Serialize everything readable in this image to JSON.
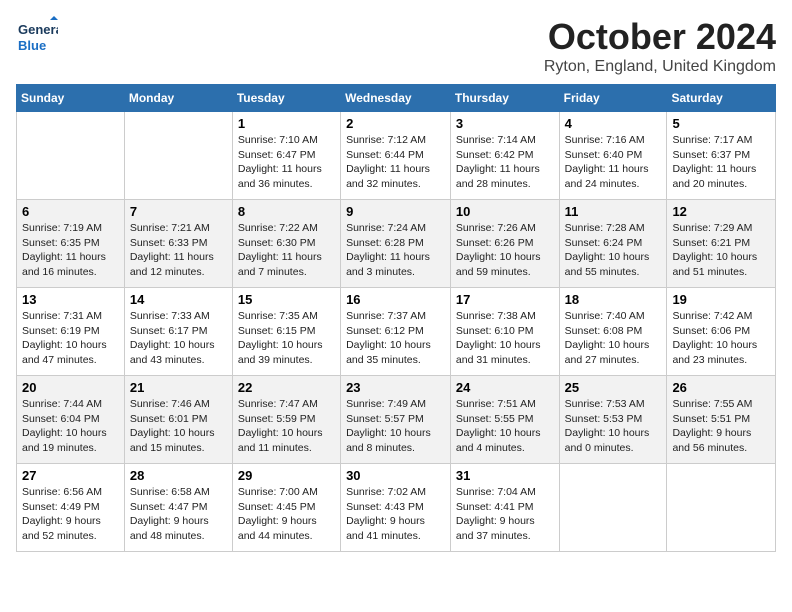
{
  "header": {
    "logo_general": "General",
    "logo_blue": "Blue",
    "month": "October 2024",
    "location": "Ryton, England, United Kingdom"
  },
  "weekdays": [
    "Sunday",
    "Monday",
    "Tuesday",
    "Wednesday",
    "Thursday",
    "Friday",
    "Saturday"
  ],
  "weeks": [
    [
      {
        "day": "",
        "sunrise": "",
        "sunset": "",
        "daylight": ""
      },
      {
        "day": "",
        "sunrise": "",
        "sunset": "",
        "daylight": ""
      },
      {
        "day": "1",
        "sunrise": "Sunrise: 7:10 AM",
        "sunset": "Sunset: 6:47 PM",
        "daylight": "Daylight: 11 hours and 36 minutes."
      },
      {
        "day": "2",
        "sunrise": "Sunrise: 7:12 AM",
        "sunset": "Sunset: 6:44 PM",
        "daylight": "Daylight: 11 hours and 32 minutes."
      },
      {
        "day": "3",
        "sunrise": "Sunrise: 7:14 AM",
        "sunset": "Sunset: 6:42 PM",
        "daylight": "Daylight: 11 hours and 28 minutes."
      },
      {
        "day": "4",
        "sunrise": "Sunrise: 7:16 AM",
        "sunset": "Sunset: 6:40 PM",
        "daylight": "Daylight: 11 hours and 24 minutes."
      },
      {
        "day": "5",
        "sunrise": "Sunrise: 7:17 AM",
        "sunset": "Sunset: 6:37 PM",
        "daylight": "Daylight: 11 hours and 20 minutes."
      }
    ],
    [
      {
        "day": "6",
        "sunrise": "Sunrise: 7:19 AM",
        "sunset": "Sunset: 6:35 PM",
        "daylight": "Daylight: 11 hours and 16 minutes."
      },
      {
        "day": "7",
        "sunrise": "Sunrise: 7:21 AM",
        "sunset": "Sunset: 6:33 PM",
        "daylight": "Daylight: 11 hours and 12 minutes."
      },
      {
        "day": "8",
        "sunrise": "Sunrise: 7:22 AM",
        "sunset": "Sunset: 6:30 PM",
        "daylight": "Daylight: 11 hours and 7 minutes."
      },
      {
        "day": "9",
        "sunrise": "Sunrise: 7:24 AM",
        "sunset": "Sunset: 6:28 PM",
        "daylight": "Daylight: 11 hours and 3 minutes."
      },
      {
        "day": "10",
        "sunrise": "Sunrise: 7:26 AM",
        "sunset": "Sunset: 6:26 PM",
        "daylight": "Daylight: 10 hours and 59 minutes."
      },
      {
        "day": "11",
        "sunrise": "Sunrise: 7:28 AM",
        "sunset": "Sunset: 6:24 PM",
        "daylight": "Daylight: 10 hours and 55 minutes."
      },
      {
        "day": "12",
        "sunrise": "Sunrise: 7:29 AM",
        "sunset": "Sunset: 6:21 PM",
        "daylight": "Daylight: 10 hours and 51 minutes."
      }
    ],
    [
      {
        "day": "13",
        "sunrise": "Sunrise: 7:31 AM",
        "sunset": "Sunset: 6:19 PM",
        "daylight": "Daylight: 10 hours and 47 minutes."
      },
      {
        "day": "14",
        "sunrise": "Sunrise: 7:33 AM",
        "sunset": "Sunset: 6:17 PM",
        "daylight": "Daylight: 10 hours and 43 minutes."
      },
      {
        "day": "15",
        "sunrise": "Sunrise: 7:35 AM",
        "sunset": "Sunset: 6:15 PM",
        "daylight": "Daylight: 10 hours and 39 minutes."
      },
      {
        "day": "16",
        "sunrise": "Sunrise: 7:37 AM",
        "sunset": "Sunset: 6:12 PM",
        "daylight": "Daylight: 10 hours and 35 minutes."
      },
      {
        "day": "17",
        "sunrise": "Sunrise: 7:38 AM",
        "sunset": "Sunset: 6:10 PM",
        "daylight": "Daylight: 10 hours and 31 minutes."
      },
      {
        "day": "18",
        "sunrise": "Sunrise: 7:40 AM",
        "sunset": "Sunset: 6:08 PM",
        "daylight": "Daylight: 10 hours and 27 minutes."
      },
      {
        "day": "19",
        "sunrise": "Sunrise: 7:42 AM",
        "sunset": "Sunset: 6:06 PM",
        "daylight": "Daylight: 10 hours and 23 minutes."
      }
    ],
    [
      {
        "day": "20",
        "sunrise": "Sunrise: 7:44 AM",
        "sunset": "Sunset: 6:04 PM",
        "daylight": "Daylight: 10 hours and 19 minutes."
      },
      {
        "day": "21",
        "sunrise": "Sunrise: 7:46 AM",
        "sunset": "Sunset: 6:01 PM",
        "daylight": "Daylight: 10 hours and 15 minutes."
      },
      {
        "day": "22",
        "sunrise": "Sunrise: 7:47 AM",
        "sunset": "Sunset: 5:59 PM",
        "daylight": "Daylight: 10 hours and 11 minutes."
      },
      {
        "day": "23",
        "sunrise": "Sunrise: 7:49 AM",
        "sunset": "Sunset: 5:57 PM",
        "daylight": "Daylight: 10 hours and 8 minutes."
      },
      {
        "day": "24",
        "sunrise": "Sunrise: 7:51 AM",
        "sunset": "Sunset: 5:55 PM",
        "daylight": "Daylight: 10 hours and 4 minutes."
      },
      {
        "day": "25",
        "sunrise": "Sunrise: 7:53 AM",
        "sunset": "Sunset: 5:53 PM",
        "daylight": "Daylight: 10 hours and 0 minutes."
      },
      {
        "day": "26",
        "sunrise": "Sunrise: 7:55 AM",
        "sunset": "Sunset: 5:51 PM",
        "daylight": "Daylight: 9 hours and 56 minutes."
      }
    ],
    [
      {
        "day": "27",
        "sunrise": "Sunrise: 6:56 AM",
        "sunset": "Sunset: 4:49 PM",
        "daylight": "Daylight: 9 hours and 52 minutes."
      },
      {
        "day": "28",
        "sunrise": "Sunrise: 6:58 AM",
        "sunset": "Sunset: 4:47 PM",
        "daylight": "Daylight: 9 hours and 48 minutes."
      },
      {
        "day": "29",
        "sunrise": "Sunrise: 7:00 AM",
        "sunset": "Sunset: 4:45 PM",
        "daylight": "Daylight: 9 hours and 44 minutes."
      },
      {
        "day": "30",
        "sunrise": "Sunrise: 7:02 AM",
        "sunset": "Sunset: 4:43 PM",
        "daylight": "Daylight: 9 hours and 41 minutes."
      },
      {
        "day": "31",
        "sunrise": "Sunrise: 7:04 AM",
        "sunset": "Sunset: 4:41 PM",
        "daylight": "Daylight: 9 hours and 37 minutes."
      },
      {
        "day": "",
        "sunrise": "",
        "sunset": "",
        "daylight": ""
      },
      {
        "day": "",
        "sunrise": "",
        "sunset": "",
        "daylight": ""
      }
    ]
  ]
}
